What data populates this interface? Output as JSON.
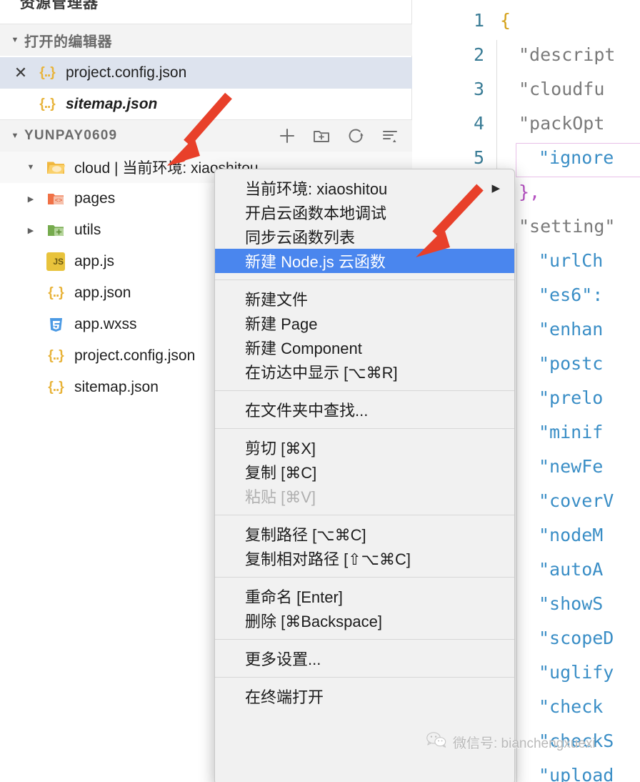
{
  "sidebar": {
    "title": "资源管理器",
    "open_editors": {
      "label": "打开的编辑器",
      "twisty": "▼",
      "items": [
        {
          "name": "project.config.json",
          "icon": "json-icon",
          "close": "✕",
          "selected": true,
          "italic": false
        },
        {
          "name": "sitemap.json",
          "icon": "json-icon",
          "close": "",
          "selected": false,
          "italic": true
        }
      ]
    },
    "project": {
      "label": "YUNPAY0609",
      "twisty": "▼",
      "toolbar": [
        {
          "name": "new-file-icon",
          "label": "新建文件"
        },
        {
          "name": "new-folder-icon",
          "label": "新建文件夹"
        },
        {
          "name": "refresh-icon",
          "label": "刷新"
        },
        {
          "name": "collapse-all-icon",
          "label": "折叠全部"
        }
      ],
      "tree": [
        {
          "name": "cloud | 当前环境: xiaoshitou",
          "icon": "folder-cloud-icon",
          "arrow": "▼",
          "depth": 1
        },
        {
          "name": "pages",
          "icon": "folder-pages-icon",
          "arrow": "▶",
          "depth": 2
        },
        {
          "name": "utils",
          "icon": "folder-utils-icon",
          "arrow": "▶",
          "depth": 2
        },
        {
          "name": "app.js",
          "icon": "js-icon",
          "arrow": "",
          "depth": 2
        },
        {
          "name": "app.json",
          "icon": "json-icon",
          "arrow": "",
          "depth": 2
        },
        {
          "name": "app.wxss",
          "icon": "wxss-icon",
          "arrow": "",
          "depth": 2
        },
        {
          "name": "project.config.json",
          "icon": "json-icon",
          "arrow": "",
          "depth": 2
        },
        {
          "name": "sitemap.json",
          "icon": "json-icon",
          "arrow": "",
          "depth": 2
        }
      ]
    }
  },
  "context_menu": {
    "groups": [
      {
        "items": [
          {
            "label": "当前环境: xiaoshitou",
            "submenu": "▶",
            "highlight": false,
            "disabled": false
          },
          {
            "label": "开启云函数本地调试",
            "submenu": "",
            "highlight": false,
            "disabled": false
          },
          {
            "label": "同步云函数列表",
            "submenu": "",
            "highlight": false,
            "disabled": false
          },
          {
            "label": "新建 Node.js 云函数",
            "submenu": "",
            "highlight": true,
            "disabled": false
          }
        ]
      },
      {
        "items": [
          {
            "label": "新建文件",
            "submenu": "",
            "highlight": false,
            "disabled": false
          },
          {
            "label": "新建 Page",
            "submenu": "",
            "highlight": false,
            "disabled": false
          },
          {
            "label": "新建 Component",
            "submenu": "",
            "highlight": false,
            "disabled": false
          },
          {
            "label": "在访达中显示 [⌥⌘R]",
            "submenu": "",
            "highlight": false,
            "disabled": false
          }
        ]
      },
      {
        "items": [
          {
            "label": "在文件夹中查找...",
            "submenu": "",
            "highlight": false,
            "disabled": false
          }
        ]
      },
      {
        "items": [
          {
            "label": "剪切 [⌘X]",
            "submenu": "",
            "highlight": false,
            "disabled": false
          },
          {
            "label": "复制 [⌘C]",
            "submenu": "",
            "highlight": false,
            "disabled": false
          },
          {
            "label": "粘贴 [⌘V]",
            "submenu": "",
            "highlight": false,
            "disabled": true
          }
        ]
      },
      {
        "items": [
          {
            "label": "复制路径 [⌥⌘C]",
            "submenu": "",
            "highlight": false,
            "disabled": false
          },
          {
            "label": "复制相对路径 [⇧⌥⌘C]",
            "submenu": "",
            "highlight": false,
            "disabled": false
          }
        ]
      },
      {
        "items": [
          {
            "label": "重命名 [Enter]",
            "submenu": "",
            "highlight": false,
            "disabled": false
          },
          {
            "label": "删除 [⌘Backspace]",
            "submenu": "",
            "highlight": false,
            "disabled": false
          }
        ]
      },
      {
        "items": [
          {
            "label": "更多设置...",
            "submenu": "",
            "highlight": false,
            "disabled": false
          }
        ]
      },
      {
        "items": [
          {
            "label": "在终端打开",
            "submenu": "",
            "highlight": false,
            "disabled": false
          }
        ]
      }
    ]
  },
  "editor": {
    "line_numbers": [
      "1",
      "2",
      "3",
      "4",
      "5"
    ],
    "lines": [
      {
        "num": "1",
        "text": "{",
        "cls": "c-brace"
      },
      {
        "num": "2",
        "text": "\"descript",
        "cls": "c-key"
      },
      {
        "num": "3",
        "text": "\"cloudfu",
        "cls": "c-key"
      },
      {
        "num": "4",
        "text": "\"packOpt",
        "cls": "c-key"
      },
      {
        "num": "5",
        "text": "\"ignore",
        "cls": "c-prop"
      }
    ],
    "tail_lines": [
      {
        "text": "},",
        "cls": "c-close"
      },
      {
        "text": "\"setting\"",
        "cls": "c-key"
      },
      {
        "text": "\"urlCh",
        "cls": "c-prop"
      },
      {
        "text": "\"es6\":",
        "cls": "c-prop"
      },
      {
        "text": "\"enhan",
        "cls": "c-prop"
      },
      {
        "text": "\"postc",
        "cls": "c-prop"
      },
      {
        "text": "\"prelo",
        "cls": "c-prop"
      },
      {
        "text": "\"minif",
        "cls": "c-prop"
      },
      {
        "text": "\"newFe",
        "cls": "c-prop"
      },
      {
        "text": "\"coverV",
        "cls": "c-prop"
      },
      {
        "text": "\"nodeM",
        "cls": "c-prop"
      },
      {
        "text": "\"autoA",
        "cls": "c-prop"
      },
      {
        "text": "\"showS",
        "cls": "c-prop"
      },
      {
        "text": "\"scopeD",
        "cls": "c-prop"
      },
      {
        "text": "\"uglify",
        "cls": "c-prop"
      },
      {
        "text": "\"check",
        "cls": "c-prop"
      },
      {
        "text": "\"checkS",
        "cls": "c-prop"
      },
      {
        "text": "\"upload",
        "cls": "c-prop"
      }
    ]
  },
  "watermark": {
    "text": "微信号: bianchengxuexi",
    "icon": "wechat-icon"
  },
  "colors": {
    "highlight": "#4a86ee",
    "selection": "#dde3ee",
    "arrow_red": "#e8402a",
    "linenum": "#3a7c96",
    "json_icon": "#e8b339"
  }
}
